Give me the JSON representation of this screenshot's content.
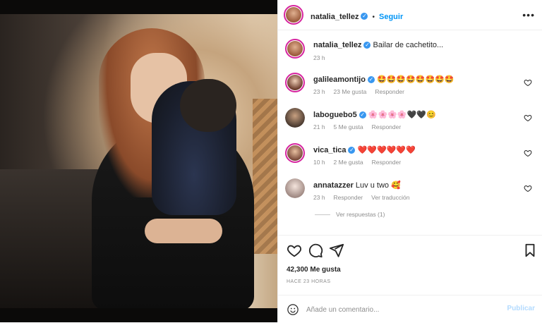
{
  "post": {
    "author": "natalia_tellez",
    "follow_label": "Seguir",
    "caption_text": "Bailar de cachetito...",
    "caption_time": "23 h",
    "likes": "42,300 Me gusta",
    "posted_ago": "HACE 23 HORAS"
  },
  "comments": [
    {
      "user": "galileamontijo",
      "verified": true,
      "text": "🤩🤩🤩🤩🤩🤩🤩🤩",
      "time": "23 h",
      "likes": "23 Me gusta",
      "reply": "Responder"
    },
    {
      "user": "laboguebo5",
      "verified": true,
      "text": "🌸🌸🌸🌸🖤🖤😊",
      "time": "21 h",
      "likes": "5 Me gusta",
      "reply": "Responder"
    },
    {
      "user": "vica_tica",
      "verified": true,
      "text": "❤️❤️❤️❤️❤️❤️",
      "time": "10 h",
      "likes": "2 Me gusta",
      "reply": "Responder"
    },
    {
      "user": "annatazzer",
      "verified": false,
      "text": "Luv u two 🥰",
      "time": "23 h",
      "reply": "Responder",
      "translate": "Ver traducción"
    }
  ],
  "replies_label": "Ver respuestas (1)",
  "add_comment": {
    "placeholder": "Añade un comentario...",
    "publish_label": "Publicar"
  },
  "colors": {
    "accent": "#0095f6",
    "ring": "#d6249f",
    "publish_disabled": "#b3dbff",
    "verified": "#3897f0"
  }
}
